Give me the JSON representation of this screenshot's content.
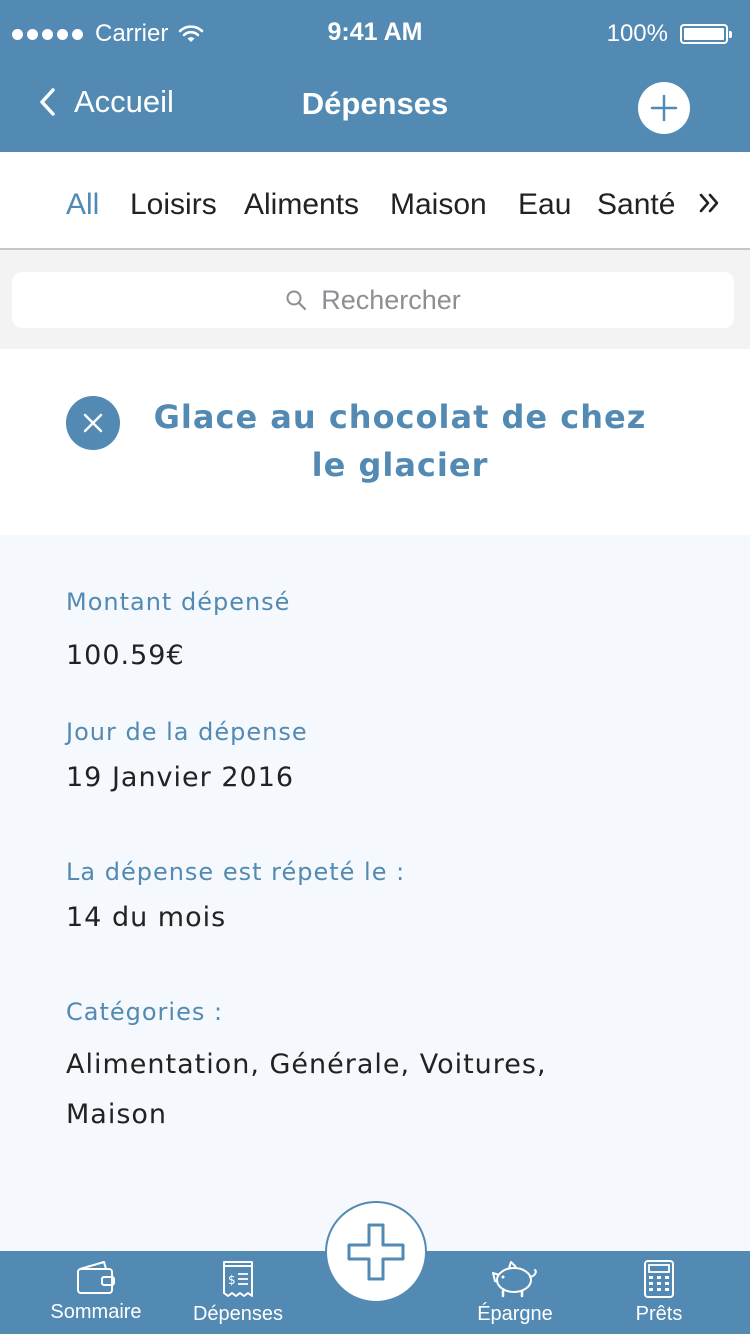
{
  "status_bar": {
    "carrier": "Carrier",
    "time": "9:41 AM",
    "battery": "100%"
  },
  "navbar": {
    "back_label": "Accueil",
    "title": "Dépenses"
  },
  "filters": {
    "tabs": [
      {
        "label": "All",
        "active": true
      },
      {
        "label": "Loisirs"
      },
      {
        "label": "Aliments"
      },
      {
        "label": "Maison"
      },
      {
        "label": "Eau"
      },
      {
        "label": "Santé"
      }
    ]
  },
  "search": {
    "placeholder": "Rechercher"
  },
  "item": {
    "title": "Glace au chocolat de chez le glacier"
  },
  "details": {
    "amount_label": "Montant dépensé",
    "amount_value": "100.59€",
    "date_label": "Jour de la dépense",
    "date_value": "19 Janvier 2016",
    "repeat_label": "La dépense est répeté le :",
    "repeat_value": "14 du mois",
    "categories_label": "Catégories :",
    "categories_value": "Alimentation, Générale, Voitures, Maison"
  },
  "tab_bar": {
    "items": [
      {
        "label": "Sommaire",
        "icon": "wallet-icon"
      },
      {
        "label": "Dépenses",
        "icon": "receipt-icon"
      },
      {
        "label": "Épargne",
        "icon": "piggy-bank-icon"
      },
      {
        "label": "Prêts",
        "icon": "calculator-icon"
      }
    ]
  },
  "colors": {
    "primary": "#528ab3",
    "detail_bg": "#f5f9fd",
    "text": "#222222"
  }
}
